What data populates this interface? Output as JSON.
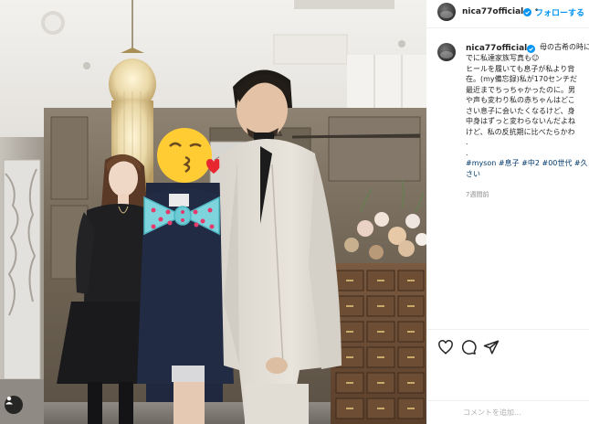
{
  "post": {
    "username": "nica77official",
    "follow_label": "フォローする",
    "separator": "•",
    "caption_lines": [
      "母の古希の時にフ",
      "でに私達家族写真も☺︎",
      "ヒールを履いても息子が私より背",
      "在。(my備忘録)私が170センチだ",
      "最近までちっちゃかったのに。男",
      "や声も変わり私の赤ちゃんはどこ",
      "さい息子に会いたくなるけど、身",
      "中身はずっと変わらないんだよね",
      "けど、私の反抗期に比べたらかわ",
      ".",
      ".",
      "#myson #息子 #中2 #00世代 #久しぶ",
      "さい"
    ],
    "time_ago": "7週間前",
    "comment_placeholder": "コメントを追加..."
  },
  "icons": {
    "like": "heart-icon",
    "comment": "comment-icon",
    "share": "share-icon",
    "verified": "verified-badge-icon",
    "tags": "user-tag-icon"
  },
  "colors": {
    "accent": "#0095f6",
    "verified": "#0095f6",
    "hashtag": "#00376b",
    "text": "#262626",
    "muted": "#8e8e8e"
  }
}
